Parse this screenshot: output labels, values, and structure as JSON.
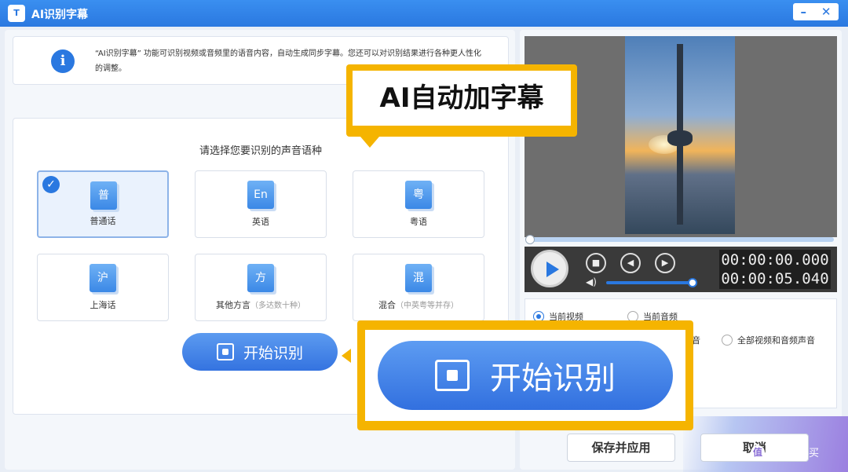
{
  "window": {
    "title": "AI识别字幕",
    "app_icon": "T",
    "minimize": "–",
    "close": "✕"
  },
  "info": {
    "text": "“AI识别字幕” 功能可识别视频或音频里的语音内容，自动生成同步字幕。您还可以对识别结果进行各种更人性化的调整。"
  },
  "language": {
    "prompt": "请选择您要识别的声音语种",
    "cards": [
      {
        "glyph": "普",
        "label": "普通话",
        "sub": "",
        "selected": true
      },
      {
        "glyph": "En",
        "label": "英语",
        "sub": "",
        "selected": false
      },
      {
        "glyph": "粤",
        "label": "粤语",
        "sub": "",
        "selected": false
      },
      {
        "glyph": "沪",
        "label": "上海话",
        "sub": "",
        "selected": false
      },
      {
        "glyph": "方",
        "label": "其他方言",
        "sub": "（多达数十种）",
        "selected": false
      },
      {
        "glyph": "混",
        "label": "混合",
        "sub": "（中英粤等并存）",
        "selected": false
      }
    ]
  },
  "start_button": {
    "label": "开始识别"
  },
  "player": {
    "time_current": "00:00:00.000",
    "time_total": "00:00:05.040",
    "volume": 1.0,
    "progress": 0.0
  },
  "options": {
    "current_video": "当前视频",
    "current_audio": "当前音频",
    "partial_audio_tail": "音",
    "all_video_audio": "全部视频和音频声音"
  },
  "footer": {
    "save_apply": "保存并应用",
    "cancel": "取消"
  },
  "callouts": {
    "title": "AI自动加字幕",
    "button": "开始识别"
  },
  "watermark": {
    "logo": "值",
    "text": "什么值得买"
  },
  "colors": {
    "accent": "#2a78e0",
    "highlight": "#f5b400"
  }
}
